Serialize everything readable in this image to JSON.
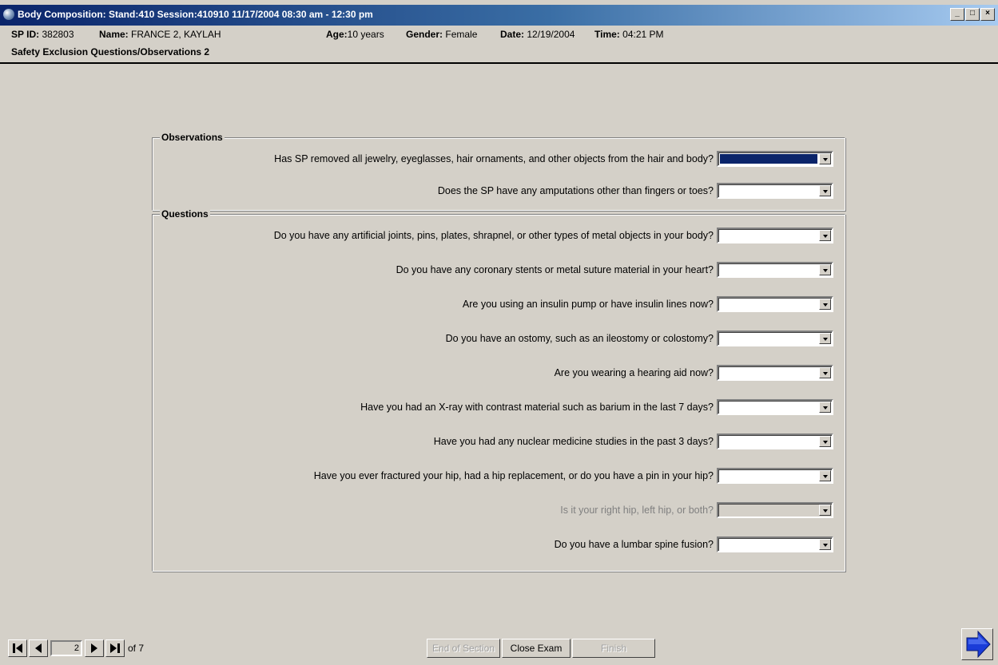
{
  "window": {
    "title": "Body Composition: Stand:410 Session:410910 11/17/2004 08:30 am - 12:30 pm",
    "controls": {
      "minimize": "_",
      "restore": "□",
      "close": "×"
    }
  },
  "info": {
    "sp_id_label": "SP ID:",
    "sp_id": "382803",
    "name_label": "Name:",
    "name": "FRANCE 2, KAYLAH",
    "age_label": "Age:",
    "age": "10 years",
    "gender_label": "Gender:",
    "gender": "Female",
    "date_label": "Date:",
    "date": "12/19/2004",
    "time_label": "Time:",
    "time": "04:21 PM"
  },
  "section_title": "Safety Exclusion Questions/Observations 2",
  "observations": {
    "legend": "Observations",
    "items": [
      {
        "text": "Has SP removed all jewelry, eyeglasses, hair ornaments, and other objects from the hair and body?",
        "value": ""
      },
      {
        "text": "Does the SP have any amputations other than fingers or toes?",
        "value": ""
      }
    ]
  },
  "questions": {
    "legend": "Questions",
    "items": [
      {
        "text": "Do you have any artificial joints, pins, plates, shrapnel, or other types of metal objects in your body?",
        "value": ""
      },
      {
        "text": "Do you have any coronary stents or metal suture material in your heart?",
        "value": ""
      },
      {
        "text": "Are you using an insulin pump or have insulin lines now?",
        "value": ""
      },
      {
        "text": "Do you have an ostomy, such as an ileostomy or colostomy?",
        "value": ""
      },
      {
        "text": "Are you wearing a hearing aid now?",
        "value": ""
      },
      {
        "text": "Have you had an X-ray with contrast material such as barium in the last 7 days?",
        "value": ""
      },
      {
        "text": "Have you had any nuclear medicine studies in the past 3 days?",
        "value": ""
      },
      {
        "text": "Have you ever fractured your hip, had a hip replacement, or do you have a pin in your hip?",
        "value": ""
      },
      {
        "text": "Is it your right hip, left hip, or both?",
        "value": "",
        "disabled": true
      },
      {
        "text": "Do you have a lumbar spine fusion?",
        "value": ""
      }
    ]
  },
  "nav": {
    "current_page": "2",
    "of_text": "of 7"
  },
  "buttons": {
    "end_of_section": "End of Section",
    "close_exam": "Close Exam",
    "finish": "Finish"
  },
  "colors": {
    "title_start": "#0a246a",
    "title_end": "#a6caf0",
    "face": "#d4d0c8",
    "selection": "#0a246a",
    "next_arrow": "#1a3cd8"
  }
}
